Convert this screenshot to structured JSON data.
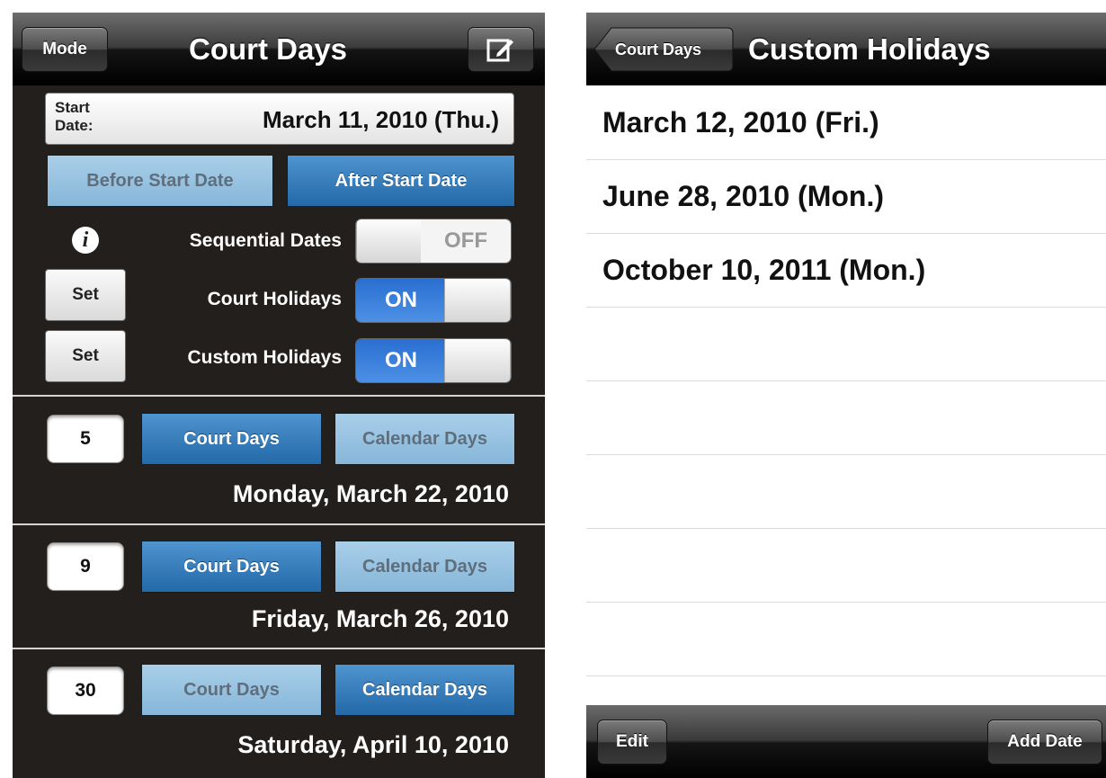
{
  "left": {
    "mode_label": "Mode",
    "title": "Court Days",
    "edit_icon": "compose-icon",
    "start_date_label": "Start Date:",
    "start_date_value": "March 11, 2010 (Thu.)",
    "direction": {
      "before_label": "Before Start Date",
      "after_label": "After Start Date",
      "selected": "after"
    },
    "info_icon": "info-icon",
    "settings": [
      {
        "label": "Sequential Dates",
        "state": "OFF",
        "set_label": ""
      },
      {
        "label": "Court Holidays",
        "state": "ON",
        "set_label": "Set"
      },
      {
        "label": "Custom Holidays",
        "state": "ON",
        "set_label": "Set"
      }
    ],
    "results": [
      {
        "count": "5",
        "court_label": "Court Days",
        "calendar_label": "Calendar Days",
        "selected": "court",
        "date": "Monday, March 22, 2010"
      },
      {
        "count": "9",
        "court_label": "Court Days",
        "calendar_label": "Calendar Days",
        "selected": "court",
        "date": "Friday, March 26, 2010"
      },
      {
        "count": "30",
        "court_label": "Court Days",
        "calendar_label": "Calendar Days",
        "selected": "calendar",
        "date": "Saturday, April 10, 2010"
      }
    ]
  },
  "right": {
    "back_label": "Court Days",
    "title": "Custom Holidays",
    "holidays": [
      "March 12, 2010 (Fri.)",
      "June 28, 2010 (Mon.)",
      "October 10, 2011 (Mon.)"
    ],
    "edit_label": "Edit",
    "add_label": "Add Date"
  },
  "colors": {
    "accent_blue": "#2a6fd0",
    "segment_selected": "#2469a8",
    "segment_unselected": "#9cc5e3",
    "panel_bg": "#221f1d"
  }
}
